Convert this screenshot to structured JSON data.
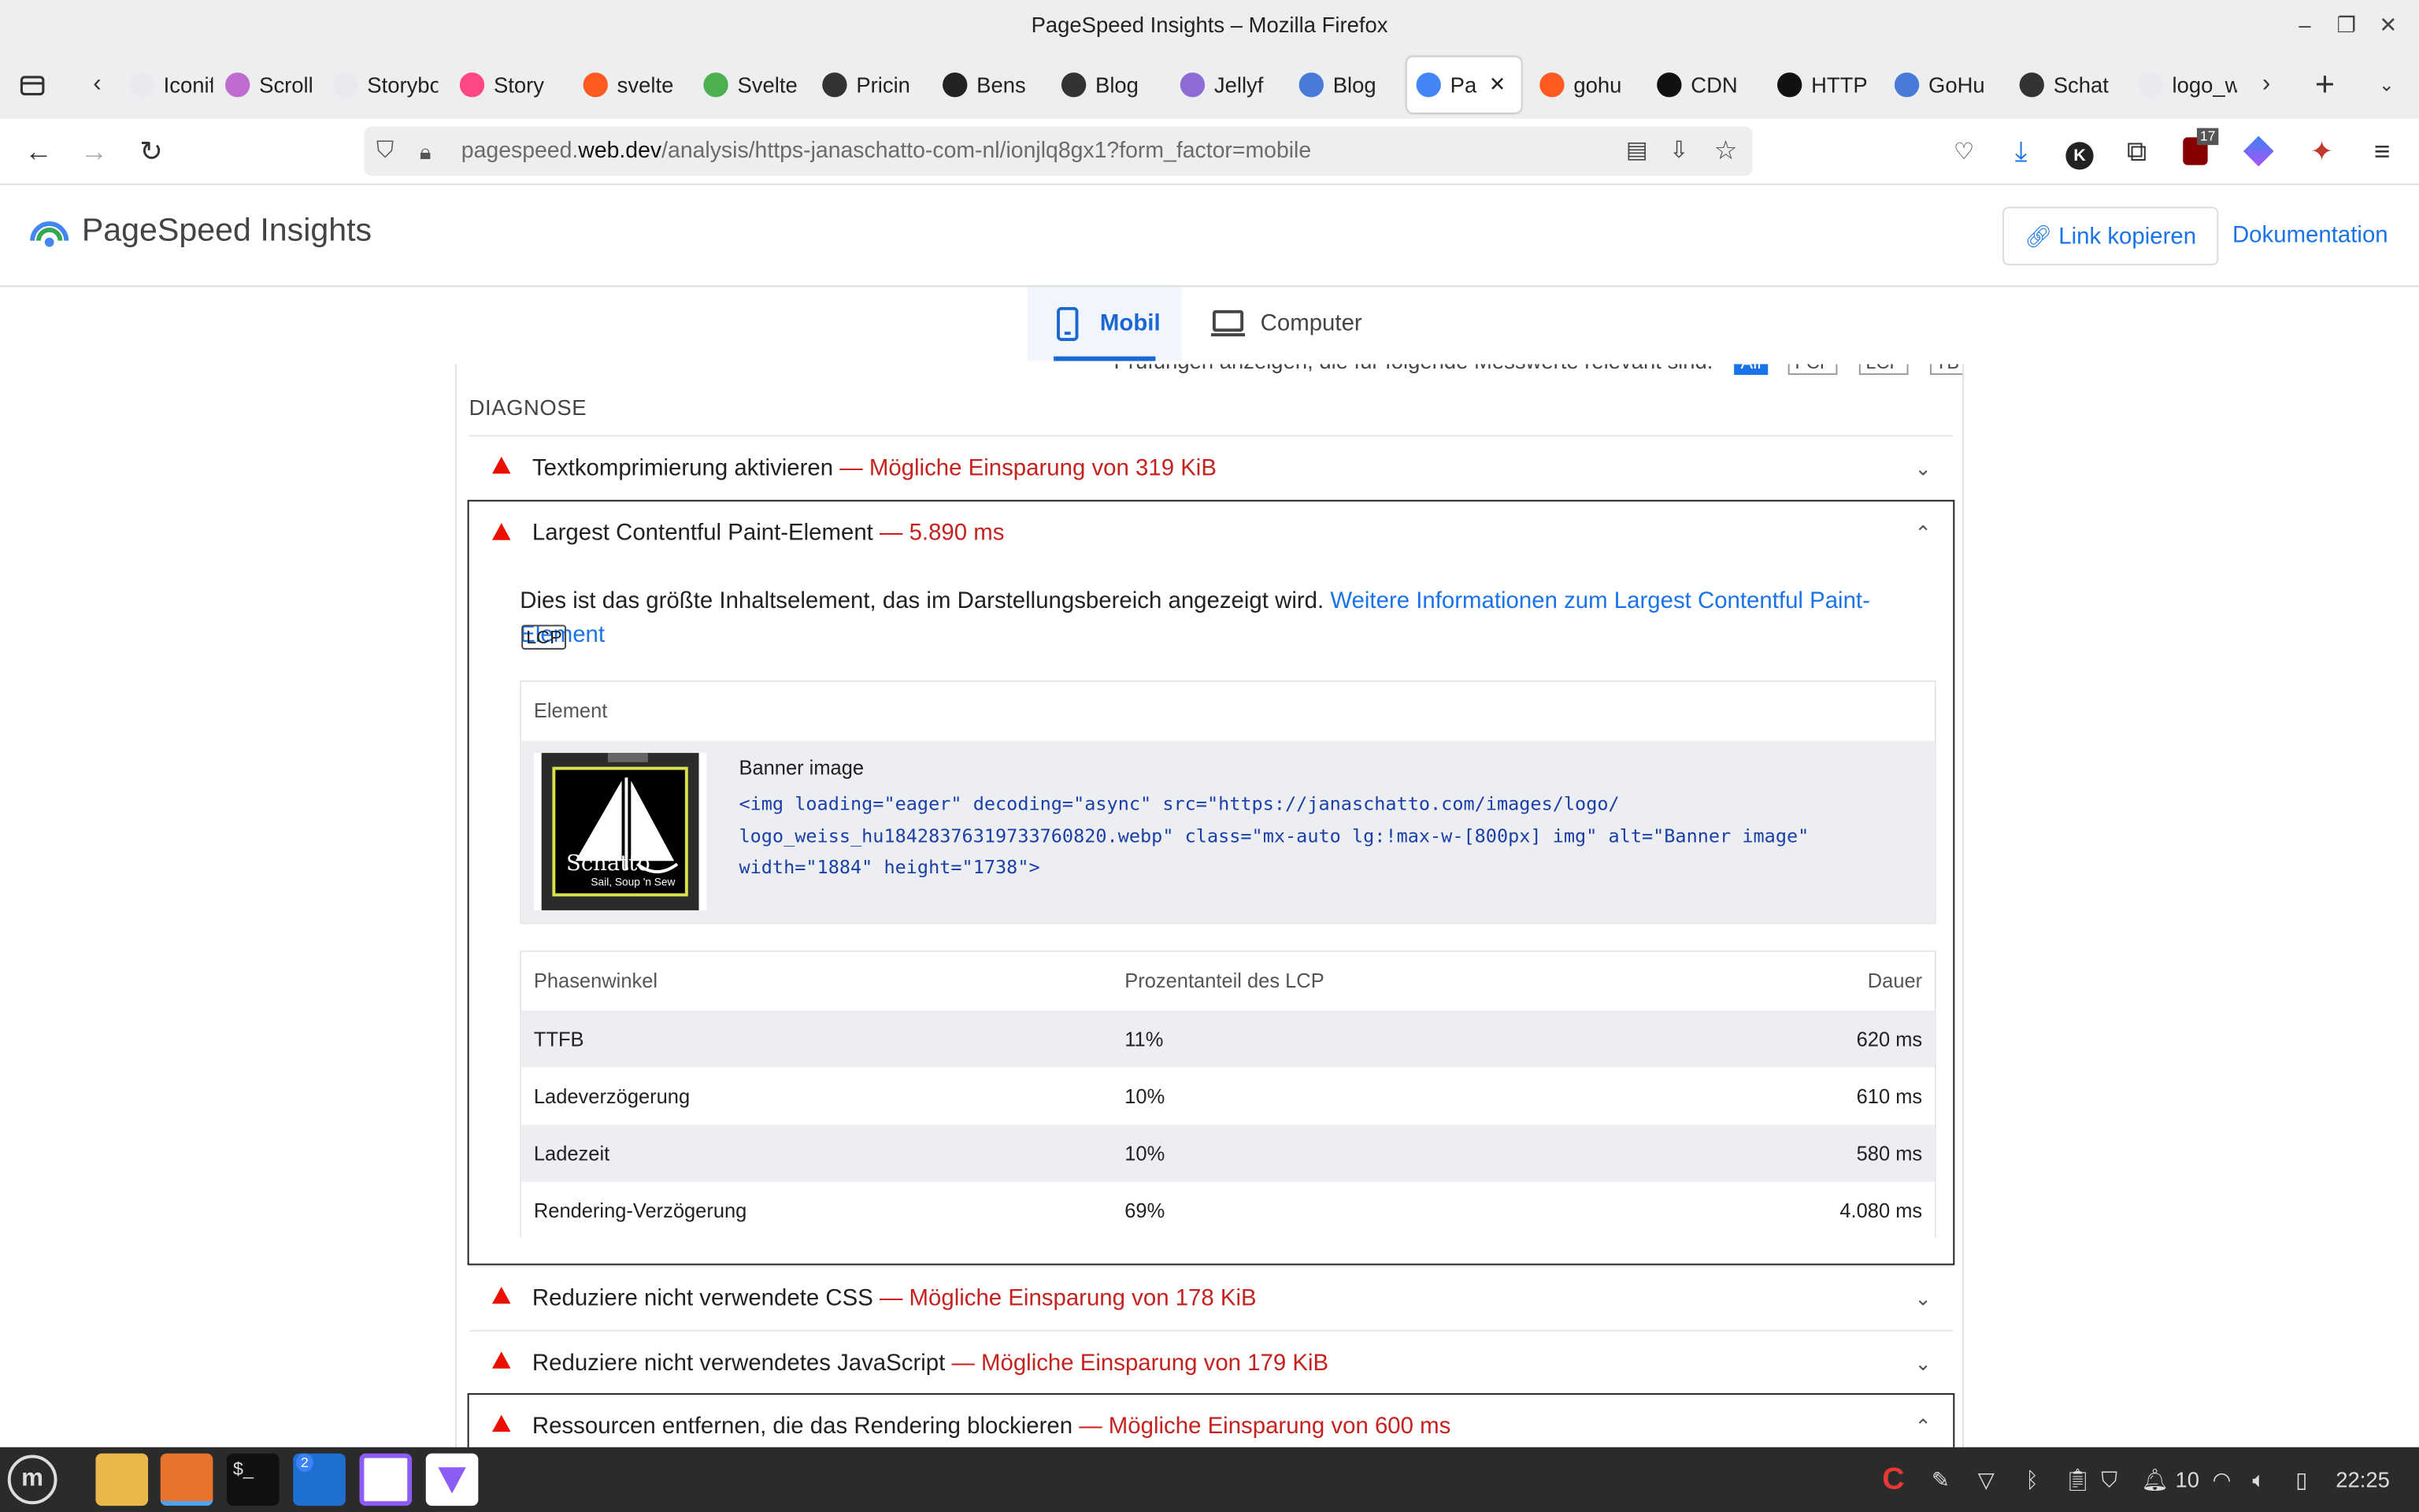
{
  "window": {
    "title": "PageSpeed Insights – Mozilla Firefox"
  },
  "tabs": [
    {
      "label": "Iconif",
      "color": "#e8eaed"
    },
    {
      "label": "Scroll",
      "color": "#c06bd0"
    },
    {
      "label": "Storyboo",
      "color": "#e8eaed"
    },
    {
      "label": "Story",
      "color": "#ff4785"
    },
    {
      "label": "svelte",
      "color": "#ff5a1f"
    },
    {
      "label": "Svelte",
      "color": "#4caf50"
    },
    {
      "label": "Pricin",
      "color": "#333333"
    },
    {
      "label": "Bens",
      "color": "#222222"
    },
    {
      "label": "Blog",
      "color": "#333333"
    },
    {
      "label": "Jellyf",
      "color": "#8e6cd6"
    },
    {
      "label": "Blog",
      "color": "#4a7ad9"
    },
    {
      "label": "Pa",
      "color": "#4285f4"
    },
    {
      "label": "gohu",
      "color": "#ff5a1f"
    },
    {
      "label": "CDN",
      "color": "#111111"
    },
    {
      "label": "HTTP",
      "color": "#111111"
    },
    {
      "label": "GoHu",
      "color": "#4a7ad9"
    },
    {
      "label": "Schat",
      "color": "#333333"
    },
    {
      "label": "logo_wei",
      "color": "#e8eaed"
    }
  ],
  "url": {
    "prefix": "pagespeed.",
    "domain": "web.dev",
    "path": "/analysis/https-janaschatto-com-nl/ionjlq8gx1?form_factor=mobile"
  },
  "toolbar_badge": "17",
  "header": {
    "brand": "PageSpeed Insights",
    "copy_link": "Link kopieren",
    "docs": "Dokumentation"
  },
  "device_tabs": {
    "mobile": "Mobil",
    "desktop": "Computer"
  },
  "filter": {
    "text": "Prüfungen anzeigen, die für folgende Messwerte relevant sind:",
    "chips": [
      "All",
      "FCP",
      "LCP",
      "TBT"
    ]
  },
  "section": {
    "title": "DIAGNOSE"
  },
  "audits": [
    {
      "title": "Textkomprimierung aktivieren",
      "savings": "— Mögliche Einsparung von 319 KiB"
    },
    {
      "title": "Largest Contentful Paint-Element",
      "savings": "— 5.890 ms"
    },
    {
      "title": "Reduziere nicht verwendete CSS",
      "savings": "— Mögliche Einsparung von 178 KiB"
    },
    {
      "title": "Reduziere nicht verwendetes JavaScript",
      "savings": "— Mögliche Einsparung von 179 KiB"
    },
    {
      "title": "Ressourcen entfernen, die das Rendering blockieren",
      "savings": "— Mögliche Einsparung von 600 ms"
    }
  ],
  "lcp_detail": {
    "description": "Dies ist das größte Inhaltselement, das im Darstellungsbereich angezeigt wird.",
    "link": "Weitere Informationen zum Largest Contentful Paint-Element",
    "badge": "LCP",
    "element_header": "Element",
    "element_label": "Banner image",
    "snippet_line1": "<img loading=\"eager\" decoding=\"async\" src=\"https://janaschatto.com/images/logo/",
    "snippet_line2": "logo_weiss_hu18428376319733760820.webp\" class=\"mx-auto lg:!max-w-[800px] img\" alt=\"Banner image\"",
    "snippet_line3": "width=\"1884\" height=\"1738\">",
    "thumb_brand": "Schatto",
    "thumb_tagline": "Sail, Soup 'n Sew"
  },
  "phase_table": {
    "headers": [
      "Phasenwinkel",
      "Prozentanteil des LCP",
      "Dauer"
    ],
    "rows": [
      {
        "phase": "TTFB",
        "percent": "11%",
        "duration": "620 ms"
      },
      {
        "phase": "Ladeverzögerung",
        "percent": "10%",
        "duration": "610 ms"
      },
      {
        "phase": "Ladezeit",
        "percent": "10%",
        "duration": "580 ms"
      },
      {
        "phase": "Rendering-Verzögerung",
        "percent": "69%",
        "duration": "4.080 ms"
      }
    ]
  },
  "taskbar": {
    "vscode_badge": "2",
    "volume": "10",
    "clock": "22:25"
  },
  "colors": {
    "accent": "#1a73e8",
    "fail": "#eb0f00",
    "savings": "#c5221f"
  }
}
